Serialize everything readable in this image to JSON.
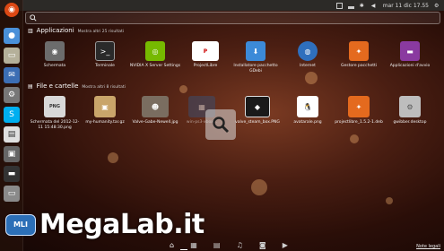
{
  "top_panel": {
    "datetime": "mar 11 dic 17.55"
  },
  "search": {
    "value": ""
  },
  "applications": {
    "title": "Applicazioni",
    "more_link": "Mostra altri 25 risultati",
    "items": [
      {
        "label": "Schermata",
        "icon": "camera-icon",
        "color": "#6c6c6c"
      },
      {
        "label": "Terminale",
        "icon": "terminal-icon",
        "color": "#2a2a2a"
      },
      {
        "label": "NVIDIA X Server Settings",
        "icon": "nvidia-icon",
        "color": "#76b900"
      },
      {
        "label": "ProjectLibre",
        "icon": "projectlibre-icon",
        "color": "#ffffff"
      },
      {
        "label": "Installatore pacchetto GDebi",
        "icon": "gdebi-icon",
        "color": "#3c8ad8"
      },
      {
        "label": "Internet",
        "icon": "globe-icon",
        "color": "#2f6fbd"
      },
      {
        "label": "Gestore pacchetti",
        "icon": "package-icon",
        "color": "#e46a1e"
      },
      {
        "label": "Applicazioni d'avvio",
        "icon": "startup-icon",
        "color": "#8a3aa0"
      }
    ]
  },
  "files": {
    "title": "File e cartelle",
    "more_link": "Mostra altri 8 risultati",
    "items": [
      {
        "label": "Schermata del 2012-12-11 15:48:30.png",
        "icon": "png-file-icon",
        "color": "#d8d8d8"
      },
      {
        "label": "my-humanity.tar.gz",
        "icon": "archive-icon",
        "color": "#c9a56a"
      },
      {
        "label": "Valve-Gabe-Newell.jpg",
        "icon": "photo-icon",
        "color": "#7a6d60"
      },
      {
        "label": "win-ps3-xbox...",
        "icon": "photo-icon",
        "color": "#3d4c6a"
      },
      {
        "label": "valve_steam_box.PNG",
        "icon": "photo-icon",
        "color": "#1a1a1a"
      },
      {
        "label": "avatarale.png",
        "icon": "penguin-icon",
        "color": "#ffffff"
      },
      {
        "label": "projectlibre_1.5.2-1.deb",
        "icon": "deb-package-icon",
        "color": "#e46a1e"
      },
      {
        "label": "gwibber.desktop",
        "icon": "gear-file-icon",
        "color": "#bdbdbd"
      }
    ],
    "png_badge": "PNG"
  },
  "lens_bar": {
    "icons": [
      "home-lens-icon",
      "applications-lens-icon",
      "files-lens-icon",
      "music-lens-icon",
      "photos-lens-icon",
      "video-lens-icon"
    ]
  },
  "legal_link": "Note legali",
  "watermark": {
    "badge": "MLI",
    "text": "MegaLab.it"
  },
  "launcher": {
    "items": [
      {
        "icon": "ubuntu-icon",
        "color": "#dd4814"
      },
      {
        "icon": "chromium-icon",
        "color": "#4a90d9"
      },
      {
        "icon": "files-icon",
        "color": "#b5b09a"
      },
      {
        "icon": "thunderbird-icon",
        "color": "#3c6eb4"
      },
      {
        "icon": "settings-icon",
        "color": "#777777"
      },
      {
        "icon": "skype-icon",
        "color": "#00aff0"
      },
      {
        "icon": "libreoffice-icon",
        "color": "#e0e0e0"
      },
      {
        "icon": "screenshot-icon",
        "color": "#666666"
      },
      {
        "icon": "terminal-launcher-icon",
        "color": "#333333"
      },
      {
        "icon": "drive-icon",
        "color": "#8a8a8a"
      },
      {
        "icon": "trash-icon",
        "color": "#999999"
      }
    ]
  }
}
